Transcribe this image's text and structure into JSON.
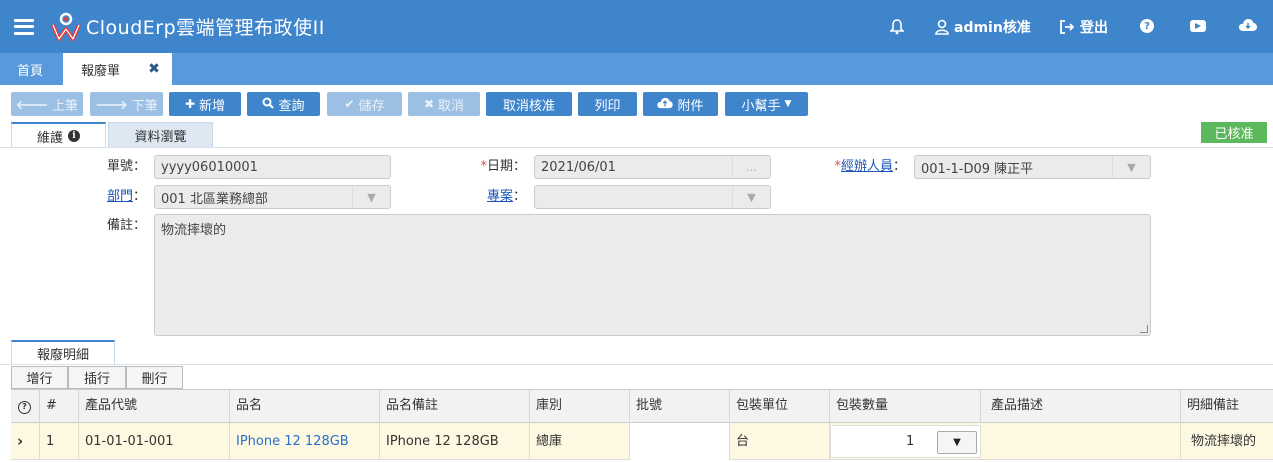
{
  "header": {
    "title": "CloudErp雲端管理布政使II",
    "user": "admin核准",
    "logout": "登出"
  },
  "tabs": {
    "home": "首頁",
    "active": "報廢單"
  },
  "toolbar": {
    "prev": "上筆",
    "next": "下筆",
    "add": "新增",
    "query": "查詢",
    "save": "儲存",
    "cancel": "取消",
    "unapprove": "取消核准",
    "print": "列印",
    "attach": "附件",
    "helper": "小幫手"
  },
  "form_tabs": {
    "maintain": "維護",
    "browse": "資料瀏覽"
  },
  "status": "已核准",
  "form": {
    "doc_no_label": "單號：",
    "doc_no": "yyyy06010001",
    "date_label": "日期：",
    "date": "2021/06/01",
    "handler_label": "經辦人員",
    "handler": "001-1-D09 陳正平",
    "dept_label": "部門",
    "dept": "001 北區業務總部",
    "project_label": "專案",
    "project": "",
    "remark_label": "備註：",
    "remark": "物流摔壞的",
    "colon": "："
  },
  "detail": {
    "tab": "報廢明細",
    "add_row": "增行",
    "insert_row": "插行",
    "delete_row": "刪行",
    "columns": [
      "#",
      "產品代號",
      "品名",
      "品名備註",
      "庫別",
      "批號",
      "包裝單位",
      "包裝數量",
      "產品描述",
      "明細備註"
    ],
    "rows": [
      {
        "index": "1",
        "code": "01-01-01-001",
        "name": "IPhone 12 128GB",
        "name_note": "IPhone 12 128GB",
        "warehouse": "總庫",
        "batch": "",
        "unit": "台",
        "qty": "1",
        "desc": "",
        "note": "物流摔壞的"
      }
    ]
  },
  "colors": {
    "header_blue": "#3f85cc",
    "tab_blue": "#5899dc",
    "approved_green": "#5cb85c",
    "row_highlight": "#fdf8e1"
  }
}
